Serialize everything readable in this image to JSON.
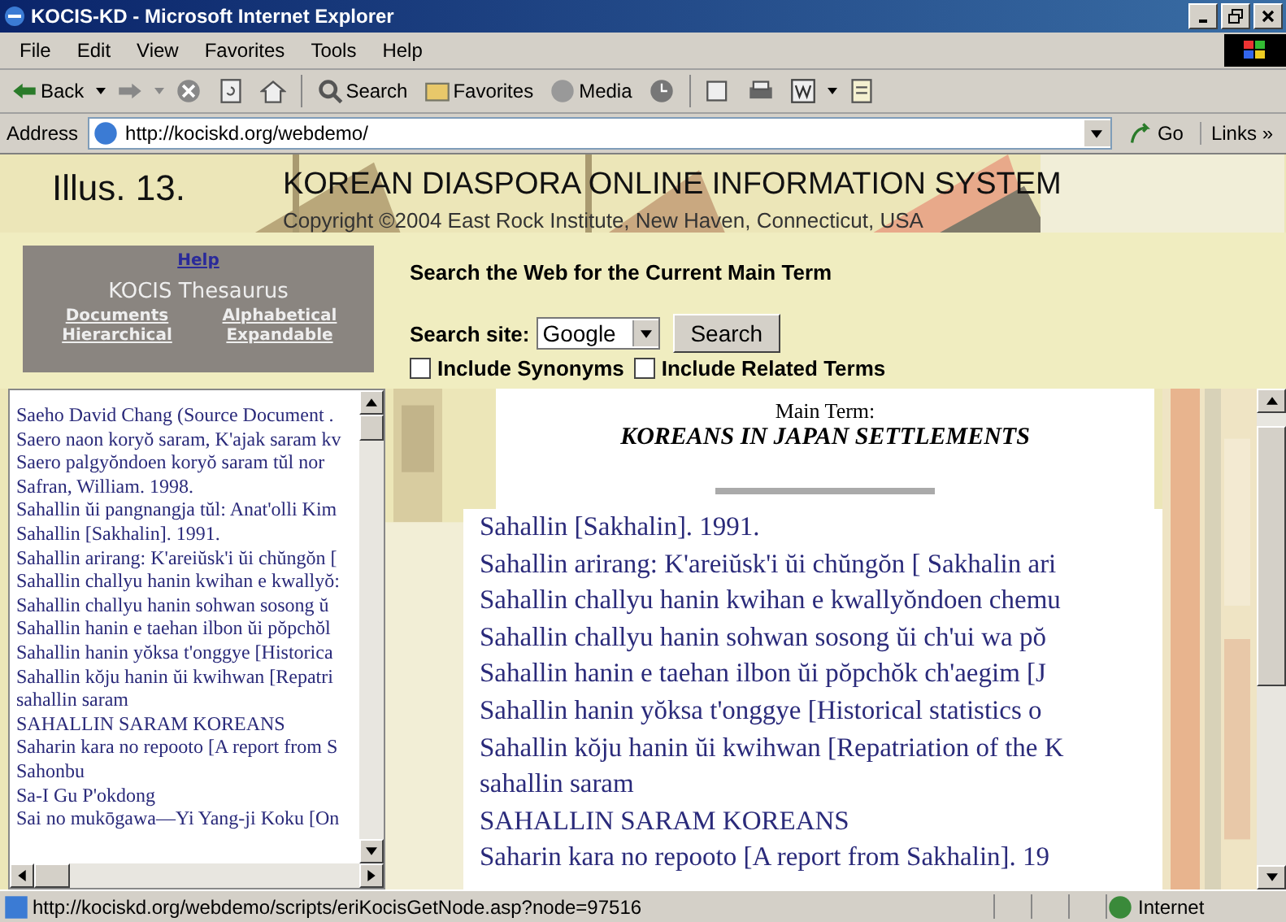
{
  "window": {
    "title": "KOCIS-KD - Microsoft Internet Explorer"
  },
  "menu": [
    "File",
    "Edit",
    "View",
    "Favorites",
    "Tools",
    "Help"
  ],
  "toolbar": {
    "back": "Back",
    "search": "Search",
    "favorites": "Favorites",
    "media": "Media"
  },
  "address": {
    "label": "Address",
    "value": "http://kociskd.org/webdemo/",
    "go": "Go",
    "links": "Links »"
  },
  "banner": {
    "illus": "Illus. 13.",
    "title": "KOREAN DIASPORA ONLINE INFORMATION SYSTEM",
    "copyright": "Copyright ©2004 East Rock Institute, New Haven, Connecticut, USA"
  },
  "thesaurus": {
    "help": "Help",
    "title": "KOCIS Thesaurus",
    "links": [
      "Documents",
      "Alphabetical",
      "Hierarchical",
      "Expandable"
    ]
  },
  "search": {
    "heading": "Search the Web for the Current Main Term",
    "site_label": "Search site:",
    "site_value": "Google",
    "button": "Search",
    "options": [
      {
        "label": "Include Synonyms",
        "checked": false
      },
      {
        "label": "Include Related Terms",
        "checked": false
      }
    ]
  },
  "term_list": [
    "Saeho David Chang (Source Document .",
    "Saero naon koryŏ saram, K'ajak saram kv",
    "Saero palgyŏndoen koryŏ saram tŭl nor",
    "Safran, William. 1998.",
    "Sahallin ŭi pangnangja tŭl: Anat'olli Kim",
    "Sahallin [Sakhalin]. 1991.",
    "Sahallin arirang: K'areiŭsk'i ŭi chŭngŏn [",
    "Sahallin challyu hanin kwihan e kwallyŏ:",
    "Sahallin challyu hanin sohwan sosong ŭ",
    "Sahallin hanin e taehan ilbon ŭi pŏpchŏl",
    "Sahallin hanin yŏksa t'onggye [Historica",
    "Sahallin kŏju hanin ŭi kwihwan [Repatri",
    "sahallin saram",
    "SAHALLIN SARAM KOREANS",
    "Saharin kara no repooto [A report from S",
    "Sahonbu",
    "Sa-I Gu P'okdong",
    "Sai no mukōgawa—Yi Yang-ji Koku [On"
  ],
  "main_term": {
    "label": "Main Term:",
    "value": "KOREANS IN JAPAN SETTLEMENTS"
  },
  "results": [
    "Sahallin [Sakhalin]. 1991.",
    "Sahallin arirang: K'areiŭsk'i ŭi chŭngŏn [ Sakhalin ari",
    "Sahallin challyu hanin kwihan e kwallyŏndoen chemu",
    "Sahallin challyu hanin sohwan sosong ŭi ch'ui wa pŏ",
    "Sahallin hanin e taehan ilbon ŭi pŏpchŏk ch'aegim [J",
    "Sahallin hanin yŏksa t'onggye [Historical statistics o",
    "Sahallin kŏju hanin ŭi kwihwan [Repatriation of the K",
    "sahallin saram",
    "SAHALLIN SARAM KOREANS",
    "Saharin kara no repooto [A report from Sakhalin]. 19"
  ],
  "status": {
    "url": "http://kociskd.org/webdemo/scripts/eriKocisGetNode.asp?node=97516",
    "zone": "Internet"
  }
}
